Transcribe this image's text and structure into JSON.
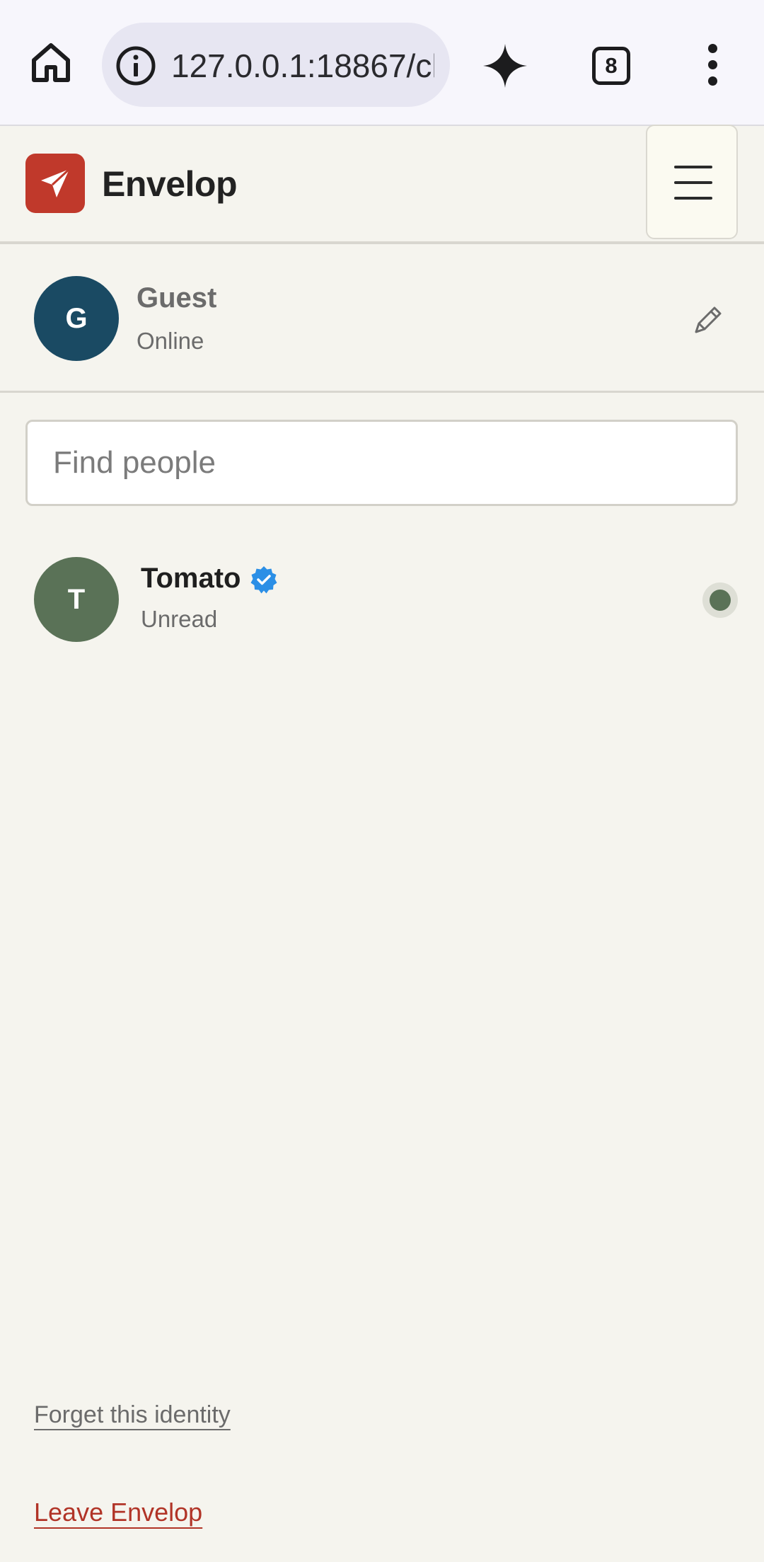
{
  "browser": {
    "url": "127.0.0.1:18867/ch",
    "tab_count": "8"
  },
  "header": {
    "app_name": "Envelop",
    "brand_color": "#c0392b"
  },
  "profile": {
    "avatar_initial": "G",
    "name": "Guest",
    "status": "Online",
    "avatar_color": "#1a4a63"
  },
  "search": {
    "placeholder": "Find people",
    "value": ""
  },
  "contacts": [
    {
      "avatar_initial": "T",
      "name": "Tomato",
      "verified": true,
      "status": "Unread",
      "avatar_color": "#5a7257"
    }
  ],
  "footer": {
    "forget_label": "Forget this identity",
    "leave_label": "Leave Envelop"
  },
  "icons": {
    "home": "home-icon",
    "info": "info-icon",
    "spark": "sparkle-icon",
    "more": "more-vertical-icon",
    "menu": "hamburger-menu-icon",
    "edit": "pencil-icon",
    "verified": "verified-badge-icon",
    "logo": "paper-plane-icon"
  }
}
